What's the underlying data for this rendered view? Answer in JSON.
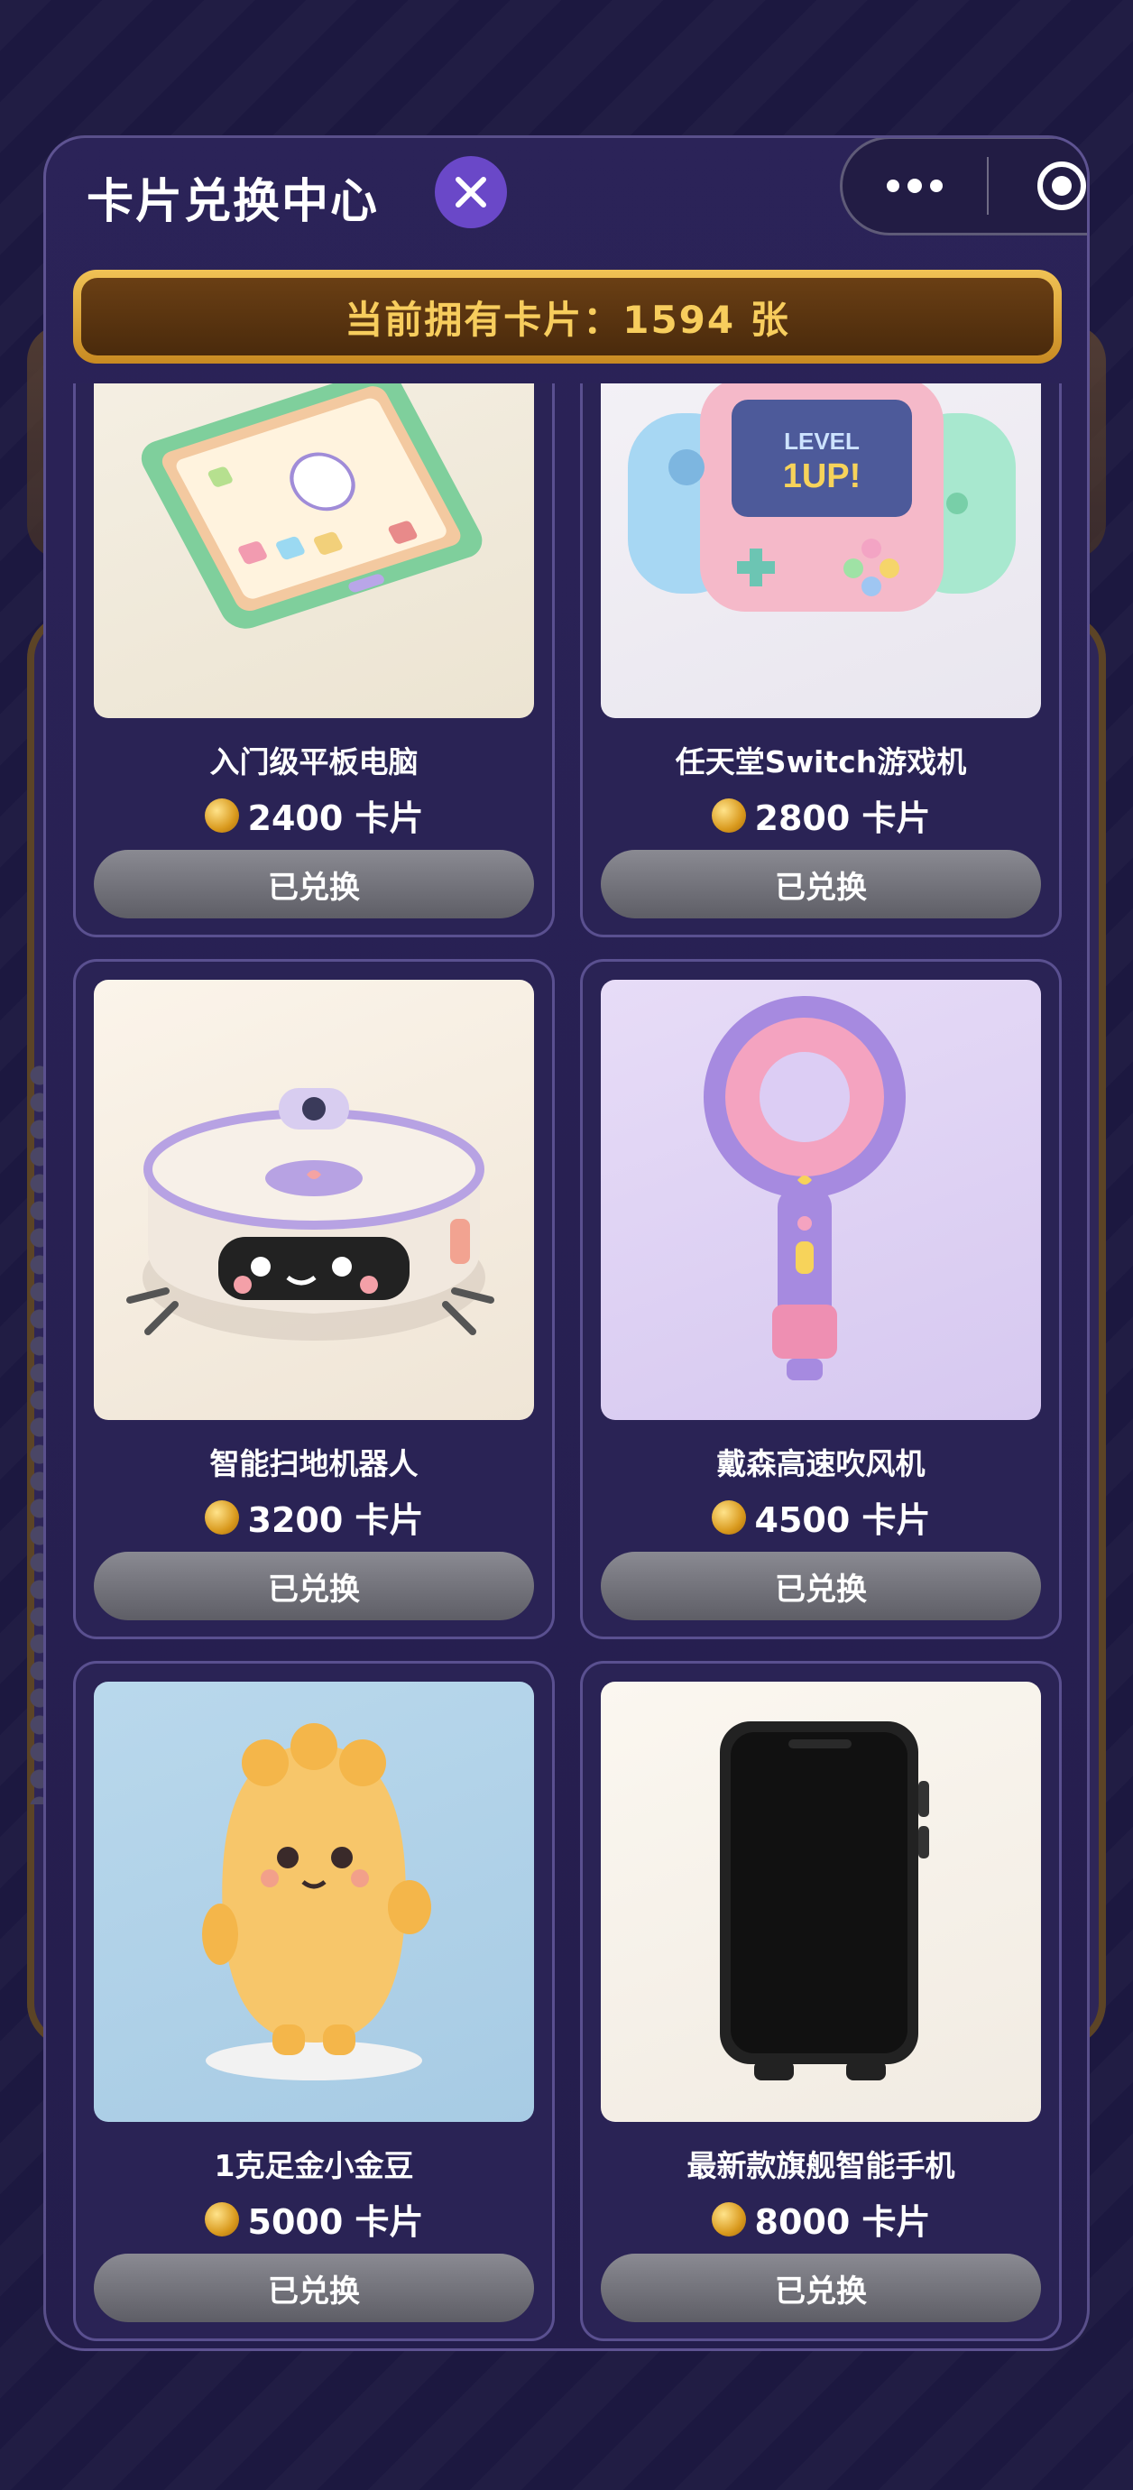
{
  "modal": {
    "title": "卡片兑换中心",
    "card_count_text": "当前拥有卡片：1594 张"
  },
  "capsule": {
    "more_icon": "more-dots-icon",
    "close_icon": "target-icon"
  },
  "price_unit": "卡片",
  "items": [
    {
      "name": "入门级平板电脑",
      "price": "2400 卡片",
      "button": "已兑换"
    },
    {
      "name": "任天堂Switch游戏机",
      "price": "2800 卡片",
      "button": "已兑换",
      "image_text": "LEVEL 1UP!"
    },
    {
      "name": "智能扫地机器人",
      "price": "3200 卡片",
      "button": "已兑换"
    },
    {
      "name": "戴森高速吹风机",
      "price": "4500 卡片",
      "button": "已兑换"
    },
    {
      "name": "1克足金小金豆",
      "price": "5000 卡片",
      "button": "已兑换"
    },
    {
      "name": "最新款旗舰智能手机",
      "price": "8000 卡片",
      "button": "已兑换"
    }
  ],
  "colors": {
    "accent_gold": "#f7cd5d",
    "panel": "#2a2355",
    "close_btn": "#6a48c8",
    "redeemed_btn": "#6e6e76"
  }
}
